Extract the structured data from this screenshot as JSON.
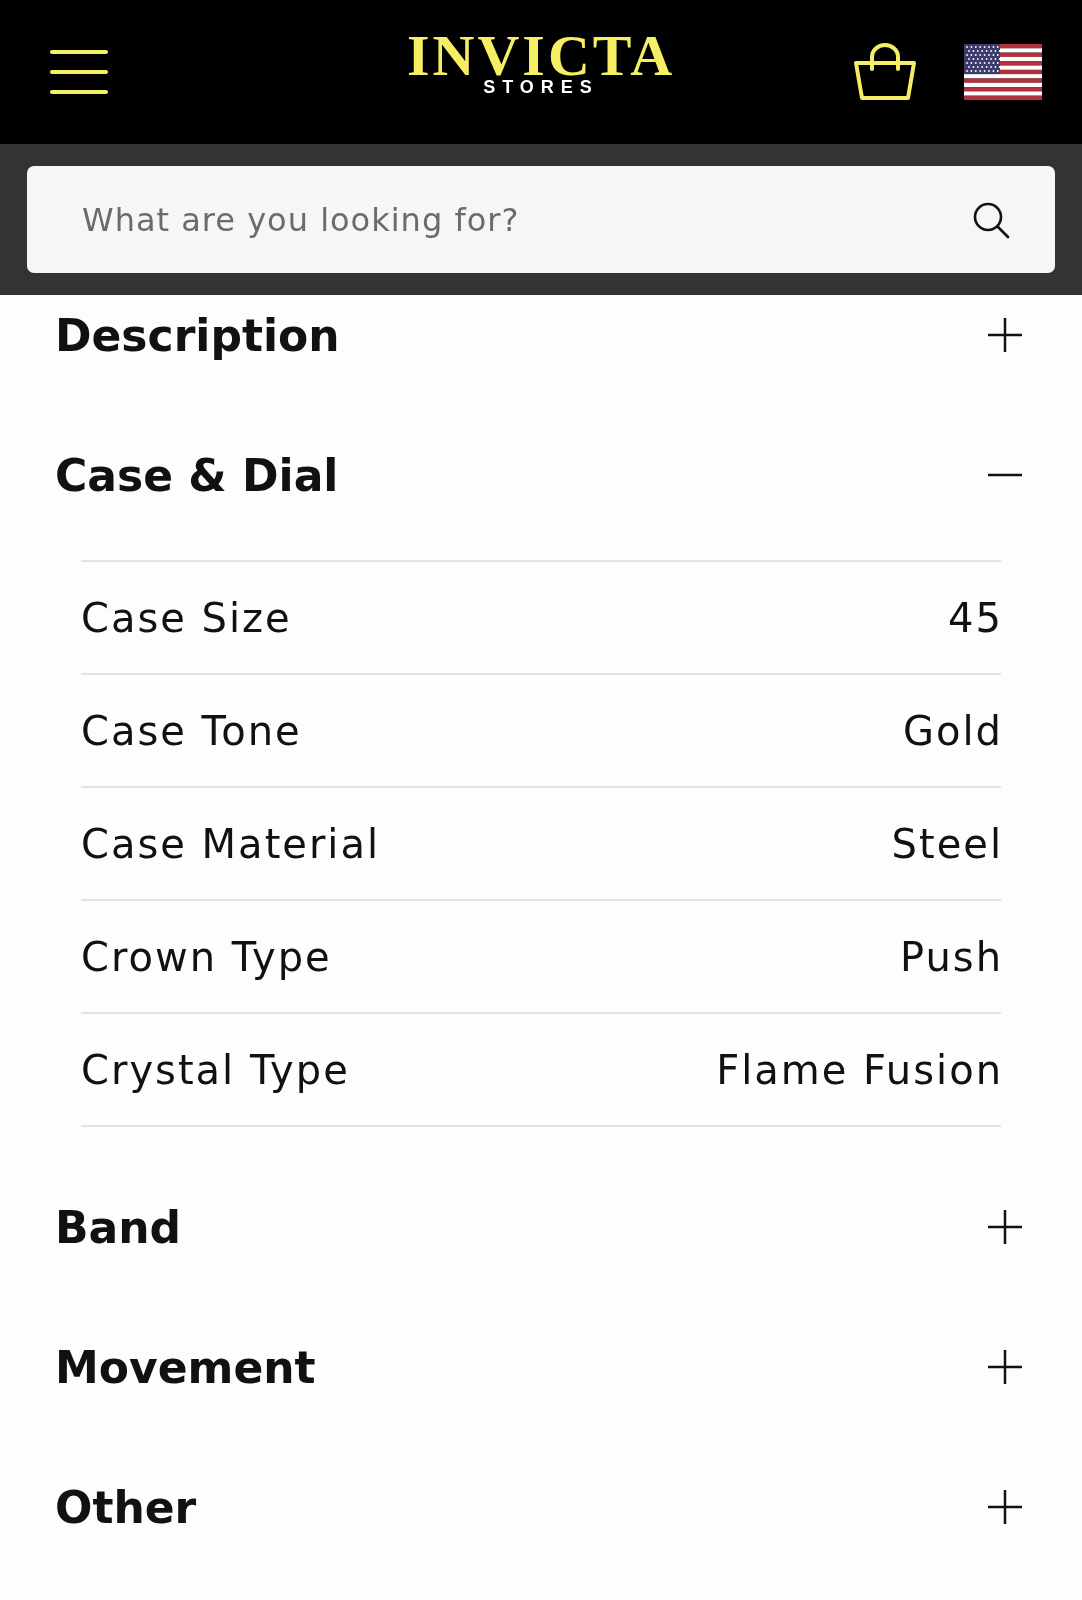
{
  "header": {
    "logo": {
      "title": "INVICTA",
      "subtitle": "STORES"
    }
  },
  "search": {
    "placeholder": "What are you looking for?"
  },
  "sections": [
    {
      "title": "Description",
      "expanded": false
    },
    {
      "title": "Case & Dial",
      "expanded": true,
      "specs": [
        {
          "label": "Case Size",
          "value": "45"
        },
        {
          "label": "Case Tone",
          "value": "Gold"
        },
        {
          "label": "Case Material",
          "value": "Steel"
        },
        {
          "label": "Crown Type",
          "value": "Push"
        },
        {
          "label": "Crystal Type",
          "value": "Flame Fusion"
        }
      ]
    },
    {
      "title": "Band",
      "expanded": false
    },
    {
      "title": "Movement",
      "expanded": false
    },
    {
      "title": "Other",
      "expanded": false
    }
  ]
}
